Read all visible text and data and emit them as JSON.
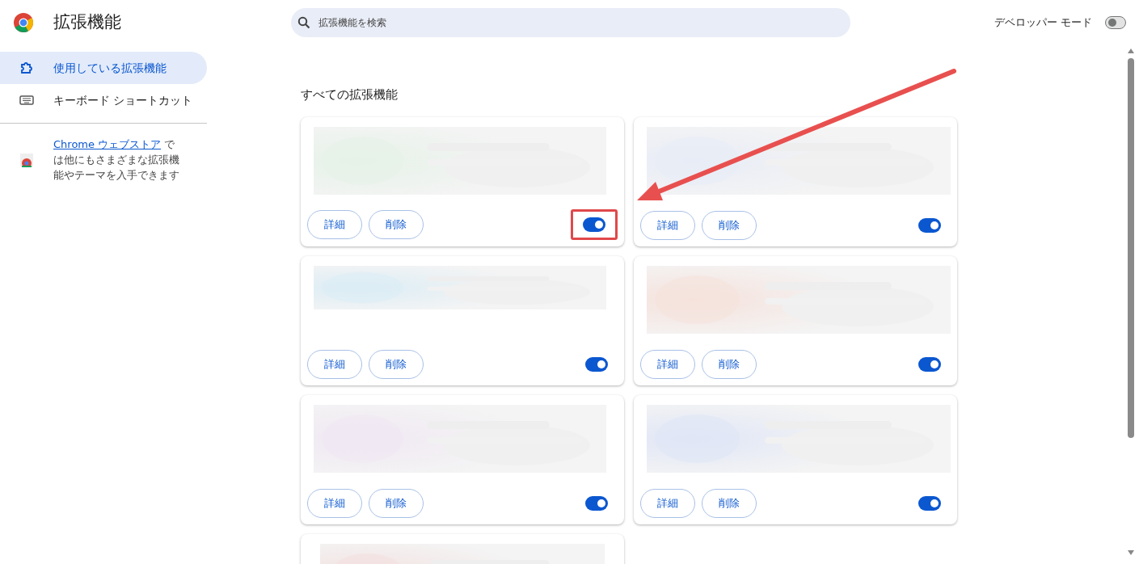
{
  "header": {
    "title": "拡張機能",
    "search": {
      "placeholder": "拡張機能を検索"
    },
    "developer_mode": {
      "label": "デベロッパー モード",
      "on": false
    }
  },
  "sidebar": {
    "items": [
      {
        "label": "使用している拡張機能",
        "selected": true,
        "kind": "puzzle"
      },
      {
        "label": "キーボード ショートカット",
        "selected": false,
        "kind": "keyboard"
      }
    ],
    "store_note": {
      "link": "Chrome ウェブストア",
      "text": " では他にもさまざまな拡張機能やテーマを入手できます"
    }
  },
  "section_title": "すべての拡張機能",
  "cards": [
    {
      "buttons": [
        "詳細",
        "削除"
      ],
      "enabled": true,
      "highlighted": true
    },
    {
      "buttons": [
        "詳細",
        "削除"
      ],
      "enabled": true,
      "highlighted": false
    },
    {
      "buttons": [
        "詳細",
        "削除"
      ],
      "enabled": true,
      "highlighted": false
    },
    {
      "buttons": [
        "詳細",
        "削除"
      ],
      "enabled": true,
      "highlighted": false
    },
    {
      "buttons": [
        "詳細",
        "削除"
      ],
      "enabled": true,
      "highlighted": false
    },
    {
      "buttons": [
        "詳細",
        "削除"
      ],
      "enabled": true,
      "highlighted": false
    },
    {
      "kind": "partial"
    }
  ]
}
